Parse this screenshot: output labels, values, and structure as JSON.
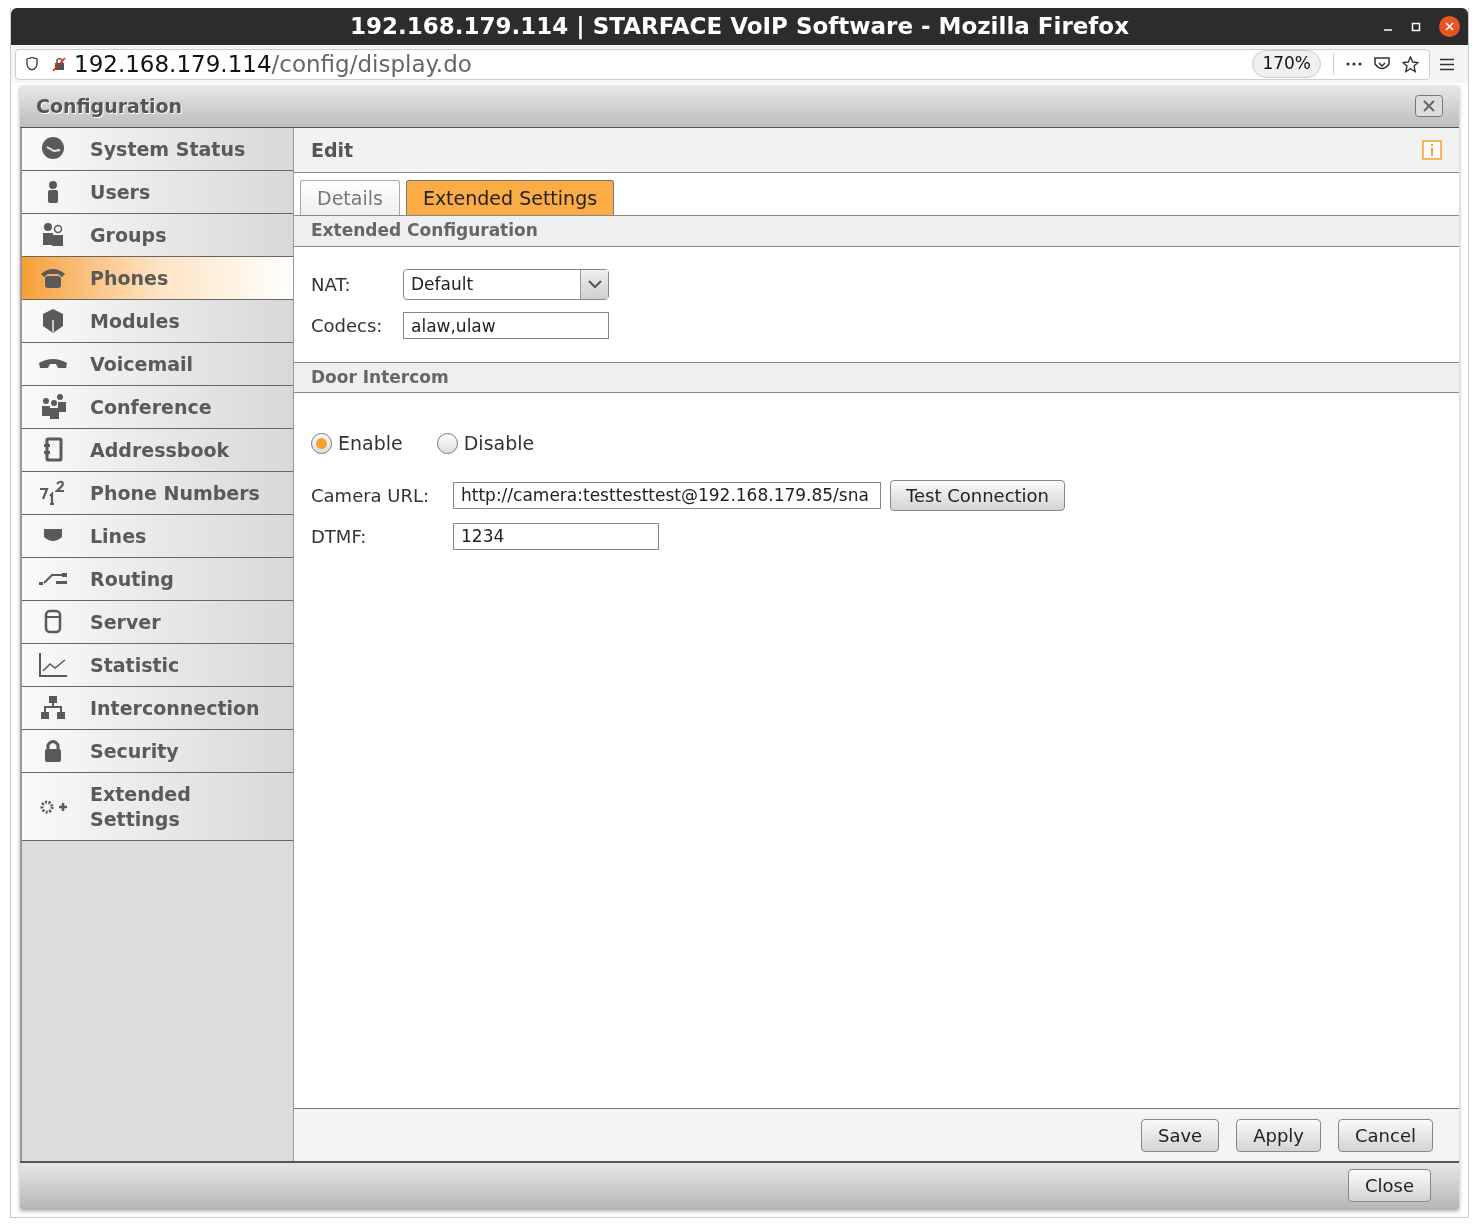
{
  "window": {
    "title": "192.168.179.114 | STARFACE VoIP Software - Mozilla Firefox"
  },
  "address_bar": {
    "host": "192.168.179.114",
    "path": "/config/display.do",
    "zoom": "170%"
  },
  "dialog": {
    "title": "Configuration"
  },
  "sidebar": {
    "items": [
      {
        "label": "System Status",
        "selected": false
      },
      {
        "label": "Users",
        "selected": false
      },
      {
        "label": "Groups",
        "selected": false
      },
      {
        "label": "Phones",
        "selected": true
      },
      {
        "label": "Modules",
        "selected": false
      },
      {
        "label": "Voicemail",
        "selected": false
      },
      {
        "label": "Conference",
        "selected": false
      },
      {
        "label": "Addressbook",
        "selected": false
      },
      {
        "label": "Phone Numbers",
        "selected": false
      },
      {
        "label": "Lines",
        "selected": false
      },
      {
        "label": "Routing",
        "selected": false
      },
      {
        "label": "Server",
        "selected": false
      },
      {
        "label": "Statistic",
        "selected": false
      },
      {
        "label": "Interconnection",
        "selected": false
      },
      {
        "label": "Security",
        "selected": false
      },
      {
        "label": "Extended Settings",
        "selected": false
      }
    ]
  },
  "panel": {
    "title": "Edit",
    "tabs": [
      {
        "label": "Details",
        "selected": false
      },
      {
        "label": "Extended Settings",
        "selected": true
      }
    ],
    "sections": [
      {
        "title": "Extended Configuration",
        "fields": [
          {
            "kind": "select",
            "label": "NAT:",
            "value": "Default"
          },
          {
            "kind": "text",
            "label": "Codecs:",
            "value": "alaw,ulaw"
          }
        ]
      },
      {
        "title": "Door Intercom",
        "radios": [
          {
            "label": "Enable",
            "selected": true
          },
          {
            "label": "Disable",
            "selected": false
          }
        ],
        "fields": [
          {
            "kind": "text",
            "label": "Camera URL:",
            "value": "http://camera:testtesttest@192.168.179.85/sna",
            "button": "Test Connection"
          },
          {
            "kind": "text",
            "label": "DTMF:",
            "value": "1234"
          }
        ]
      }
    ],
    "buttons": [
      "Save",
      "Apply",
      "Cancel"
    ]
  },
  "footer": {
    "buttons": [
      "Close"
    ]
  }
}
